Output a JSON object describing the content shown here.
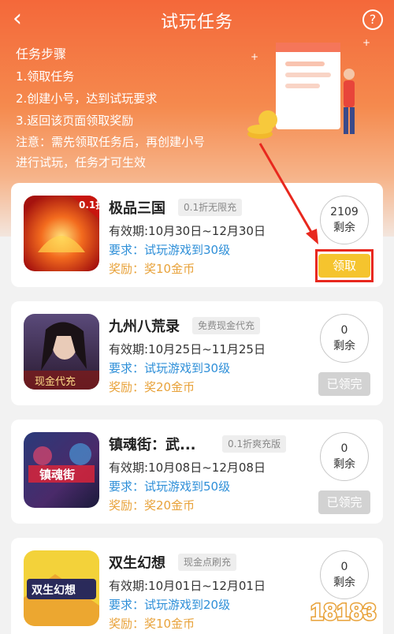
{
  "header": {
    "title": "试玩任务",
    "back_icon": "‹",
    "help_icon": "?"
  },
  "steps": {
    "title": "任务步骤",
    "items": [
      "1.领取任务",
      "2.创建小号，达到试玩要求",
      "3.返回该页面领取奖励"
    ],
    "note_1": "注意：需先领取任务后，再创建小号",
    "note_2": "进行试玩，任务才可生效"
  },
  "cards": [
    {
      "name": "极品三国",
      "tag": "0.1折无限充",
      "validity": "有效期:10月30日~12月30日",
      "req_label": "要求：",
      "req": "试玩游戏到30级",
      "rew_label": "奖励：",
      "rew": "奖10金币",
      "remain_num": "2109",
      "remain_label": "剩余",
      "button": "领取",
      "icon_badge": "0.1折"
    },
    {
      "name": "九州八荒录",
      "tag": "免费现金代充",
      "validity": "有效期:10月25日~11月25日",
      "req_label": "要求：",
      "req": "试玩游戏到30级",
      "rew_label": "奖励：",
      "rew": "奖20金币",
      "remain_num": "0",
      "remain_label": "剩余",
      "button": "已领完",
      "icon_text": "现金代充"
    },
    {
      "name": "镇魂街：武...",
      "tag": "0.1折爽充版",
      "validity": "有效期:10月08日~12月08日",
      "req_label": "要求：",
      "req": "试玩游戏到50级",
      "rew_label": "奖励：",
      "rew": "奖20金币",
      "remain_num": "0",
      "remain_label": "剩余",
      "button": "已领完",
      "icon_text": "镇魂街"
    },
    {
      "name": "双生幻想",
      "tag": "现金点刷充",
      "validity": "有效期:10月01日~12月01日",
      "req_label": "要求：",
      "req": "试玩游戏到20级",
      "rew_label": "奖励：",
      "rew": "奖10金币",
      "remain_num": "0",
      "remain_label": "剩余",
      "button": "已领完",
      "icon_text": "双生幻想"
    }
  ],
  "watermark": "18183",
  "colors": {
    "header": "#f4683a",
    "req": "#2e8fd8",
    "reward": "#e8a23a",
    "get_button": "#f5c42e",
    "done_button": "#d2d2d2",
    "highlight": "#e8281e"
  }
}
